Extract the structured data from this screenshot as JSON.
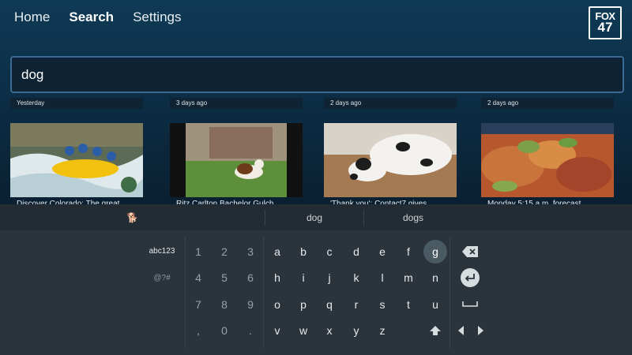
{
  "nav": {
    "home": "Home",
    "search": "Search",
    "settings": "Settings"
  },
  "logo": {
    "line1": "FOX",
    "line2": "47"
  },
  "search": {
    "value": "dog"
  },
  "results": [
    {
      "timestamp": "Yesterday",
      "caption": "Discover Colorado: The great..."
    },
    {
      "timestamp": "3 days ago",
      "caption": "Ritz Carlton Bachelor Gulch..."
    },
    {
      "timestamp": "2 days ago",
      "caption": "'Thank you': Contact7 gives..."
    },
    {
      "timestamp": "2 days ago",
      "caption": "Monday 5:15 a.m. forecast"
    }
  ],
  "suggestions": {
    "emoji": "🐕",
    "s1": "dog",
    "s2": "dogs"
  },
  "keyboard": {
    "mode1": "abc123",
    "mode2": "@?#",
    "numbers": [
      "1",
      "2",
      "3",
      "4",
      "5",
      "6",
      "7",
      "8",
      "9",
      ",",
      "0",
      "."
    ],
    "row1": [
      "a",
      "b",
      "c",
      "d",
      "e",
      "f",
      "g"
    ],
    "row2": [
      "h",
      "i",
      "j",
      "k",
      "l",
      "m",
      "n"
    ],
    "row3": [
      "o",
      "p",
      "q",
      "r",
      "s",
      "t",
      "u"
    ],
    "row4": [
      "v",
      "w",
      "x",
      "y",
      "z"
    ]
  },
  "colors": {
    "accent": "#3b6b95",
    "keyboard_bg": "#2b343b",
    "suggestion_bg": "#242c33"
  }
}
